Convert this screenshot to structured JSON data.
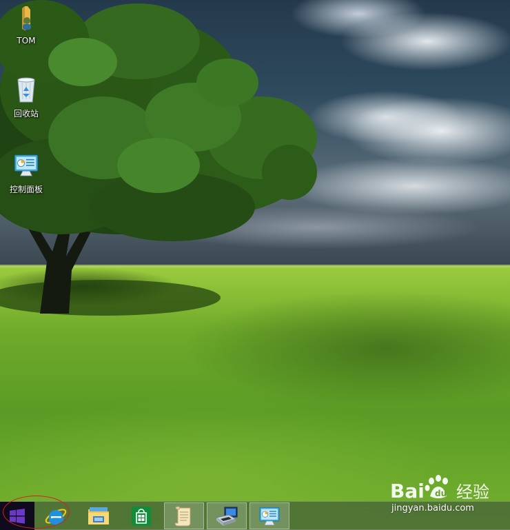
{
  "desktop": {
    "icons": [
      {
        "label": "TOM",
        "icon": "user-folder-icon"
      },
      {
        "label": "回收站",
        "icon": "recycle-bin-icon"
      },
      {
        "label": "控制面板",
        "icon": "control-panel-icon"
      }
    ]
  },
  "taskbar": {
    "buttons": [
      {
        "name": "start-button",
        "icon": "windows-logo-icon"
      },
      {
        "name": "internet-explorer",
        "icon": "internet-explorer-icon"
      },
      {
        "name": "file-explorer",
        "icon": "file-explorer-icon"
      },
      {
        "name": "store",
        "icon": "store-icon"
      },
      {
        "name": "notepad-scroll",
        "icon": "scroll-icon"
      },
      {
        "name": "network-computer",
        "icon": "network-computer-icon"
      },
      {
        "name": "control-panel",
        "icon": "control-panel-icon"
      }
    ],
    "accent_color": "#5b2ca8",
    "annotation_color": "#d81e1e"
  },
  "watermark": {
    "logo": "Bai 经验",
    "url": "jingyan.baidu.com"
  }
}
